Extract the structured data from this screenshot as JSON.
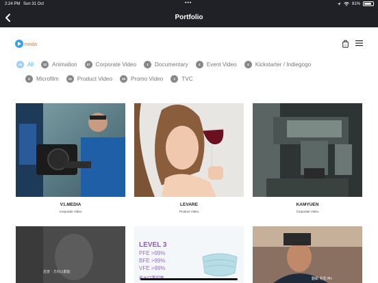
{
  "status": {
    "time": "2:24 PM",
    "date": "Sun 31 Oct",
    "dots": "•••",
    "battery": "81%",
    "battery_level": 0.81
  },
  "nav": {
    "title": "Portfolio"
  },
  "logo": {
    "text": "media"
  },
  "filters": [
    {
      "count": "46",
      "label": "All",
      "active": true
    },
    {
      "count": "12",
      "label": "Animation"
    },
    {
      "count": "27",
      "label": "Corporate Video"
    },
    {
      "count": "1",
      "label": "Documentary"
    },
    {
      "count": "4",
      "label": "Event Video"
    },
    {
      "count": "4",
      "label": "Kickstarter / Indiegogo"
    },
    {
      "count": "5",
      "label": "Microfilm"
    },
    {
      "count": "15",
      "label": "Product Video"
    },
    {
      "count": "25",
      "label": "Promo Video"
    },
    {
      "count": "1",
      "label": "TVC"
    }
  ],
  "items": [
    {
      "name": "V1.MEDIA",
      "category": "Corporate Video"
    },
    {
      "name": "LEVARE",
      "category": "Product Video"
    },
    {
      "name": "KAMYUEN",
      "category": "Corporate Video"
    }
  ],
  "row2": {
    "overlay1": "岳普 · 方向以動能",
    "level_title": "LEVEL 3",
    "level_lines": [
      "PFE >99%",
      "BFE >99%",
      "VFE >99%"
    ],
    "level_footer": "最大口罩認證",
    "caption3": "劉凱 先生 Mr."
  }
}
